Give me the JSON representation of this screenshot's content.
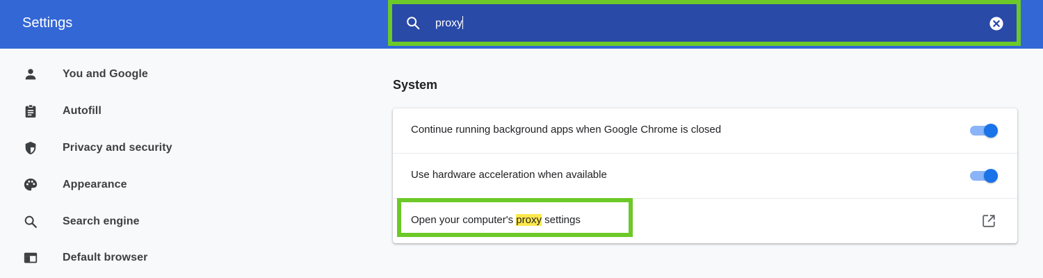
{
  "header": {
    "title": "Settings",
    "search": {
      "value": "proxy",
      "icon": "search-icon",
      "clear_icon": "clear-icon"
    }
  },
  "sidebar": {
    "items": [
      {
        "label": "You and Google",
        "icon": "person-icon"
      },
      {
        "label": "Autofill",
        "icon": "clipboard-icon"
      },
      {
        "label": "Privacy and security",
        "icon": "shield-icon"
      },
      {
        "label": "Appearance",
        "icon": "palette-icon"
      },
      {
        "label": "Search engine",
        "icon": "search-icon"
      },
      {
        "label": "Default browser",
        "icon": "browser-window-icon"
      }
    ]
  },
  "main": {
    "section_title": "System",
    "rows": [
      {
        "label": "Continue running background apps when Google Chrome is closed",
        "control": "toggle",
        "enabled": true
      },
      {
        "label": "Use hardware acceleration when available",
        "control": "toggle",
        "enabled": true
      },
      {
        "label_before": "Open your computer's ",
        "label_highlight": "proxy",
        "label_after": " settings",
        "control": "external-link",
        "icon": "open-in-new-icon"
      }
    ]
  },
  "colors": {
    "header_bg": "#3367d6",
    "search_bg": "#2a4aa8",
    "annotation_outline": "#6cc928",
    "highlight": "#fde74c",
    "toggle_on": "#1a73e8"
  }
}
